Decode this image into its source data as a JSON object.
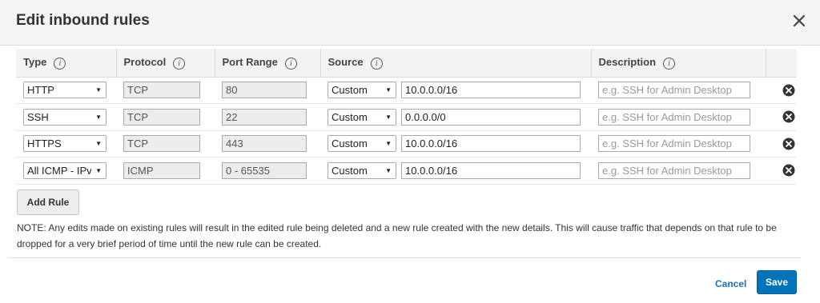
{
  "dialog": {
    "title": "Edit inbound rules",
    "close_icon": "close-icon"
  },
  "table": {
    "headers": {
      "type": "Type",
      "protocol": "Protocol",
      "port_range": "Port Range",
      "source": "Source",
      "description": "Description"
    },
    "info_glyph": "i",
    "rows": [
      {
        "type": "HTTP",
        "protocol": "TCP",
        "port_range": "80",
        "source_mode": "Custom",
        "source_value": "10.0.0.0/16",
        "description_placeholder": "e.g. SSH for Admin Desktop"
      },
      {
        "type": "SSH",
        "protocol": "TCP",
        "port_range": "22",
        "source_mode": "Custom",
        "source_value": "0.0.0.0/0",
        "description_placeholder": "e.g. SSH for Admin Desktop"
      },
      {
        "type": "HTTPS",
        "protocol": "TCP",
        "port_range": "443",
        "source_mode": "Custom",
        "source_value": "10.0.0.0/16",
        "description_placeholder": "e.g. SSH for Admin Desktop"
      },
      {
        "type": "All ICMP - IPv",
        "protocol": "ICMP",
        "port_range": "0 - 65535",
        "source_mode": "Custom",
        "source_value": "10.0.0.0/16",
        "description_placeholder": "e.g. SSH for Admin Desktop"
      }
    ],
    "delete_icon": "remove-circle-icon"
  },
  "add_rule_label": "Add Rule",
  "note": "NOTE: Any edits made on existing rules will result in the edited rule being deleted and a new rule created with the new details. This will cause traffic that depends on that rule to be dropped for a very brief period of time until the new rule can be created.",
  "footer": {
    "cancel_label": "Cancel",
    "save_label": "Save"
  },
  "colors": {
    "primary": "#0073bb",
    "link": "#1a73b5",
    "header_bg": "#f4f4f4"
  }
}
